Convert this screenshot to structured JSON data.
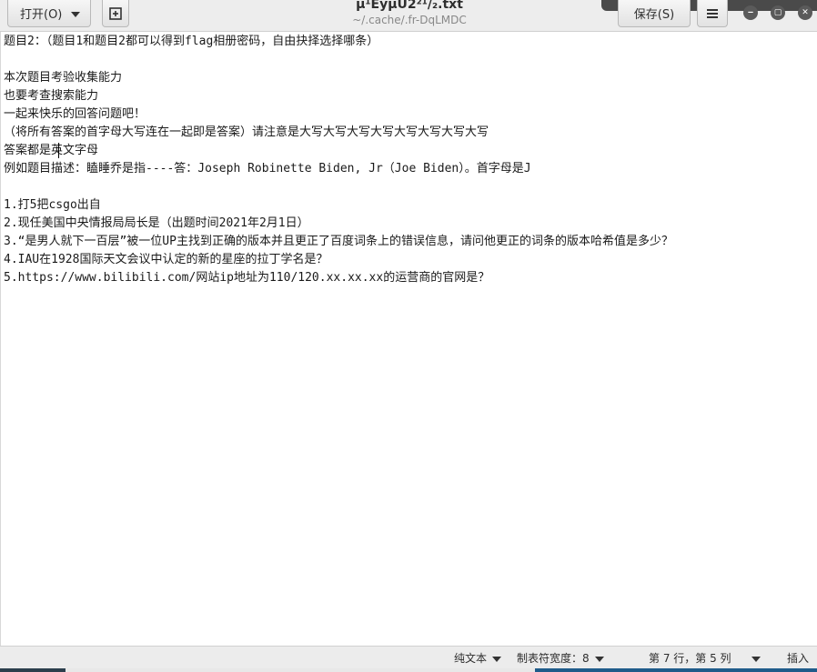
{
  "window": {
    "title": "µ¹ÈýµU2²¹/₂.txt",
    "subtitle": "~/.cache/.fr-DqLMDC"
  },
  "toolbar": {
    "open_label": "打开(O)",
    "new_icon": "new-document-icon",
    "save_label": "保存(S)",
    "menu_icon": "hamburger-menu-icon"
  },
  "window_controls": {
    "minimize_glyph": "‒",
    "maximize_glyph": "▢",
    "close_glyph": "✕"
  },
  "document": {
    "lines": [
      "题目2：（题目1和题目2都可以得到flag相册密码，自由抉择选择哪条）",
      "",
      "本次题目考验收集能力",
      "也要考查搜索能力",
      "一起来快乐的回答问题吧！",
      "（将所有答案的首字母大写连在一起即是答案）请注意是大写大写大写大写大写大写大写大写",
      "答案都是英文字母",
      "例如题目描述：瞌睡乔是指----答：Joseph Robinette Biden, Jr（Joe Biden）。首字母是J",
      "",
      "1.打5把csgo出自",
      "2.现任美国中央情报局局长是（出题时间2021年2月1日）",
      "3.“是男人就下一百层”被一位UP主找到正确的版本并且更正了百度词条上的错误信息，请问他更正的词条的版本哈希值是多少？",
      "4.IAU在1928国际天文会议中认定的新的星座的拉丁学名是？",
      "5.https://www.bilibili.com/网站ip地址为110/120.xx.xx.xx的运营商的官网是？"
    ]
  },
  "statusbar": {
    "syntax": "纯文本",
    "tab_width": "制表符宽度：8",
    "position": "第 7 行，第 5 列",
    "mode": "插入"
  }
}
